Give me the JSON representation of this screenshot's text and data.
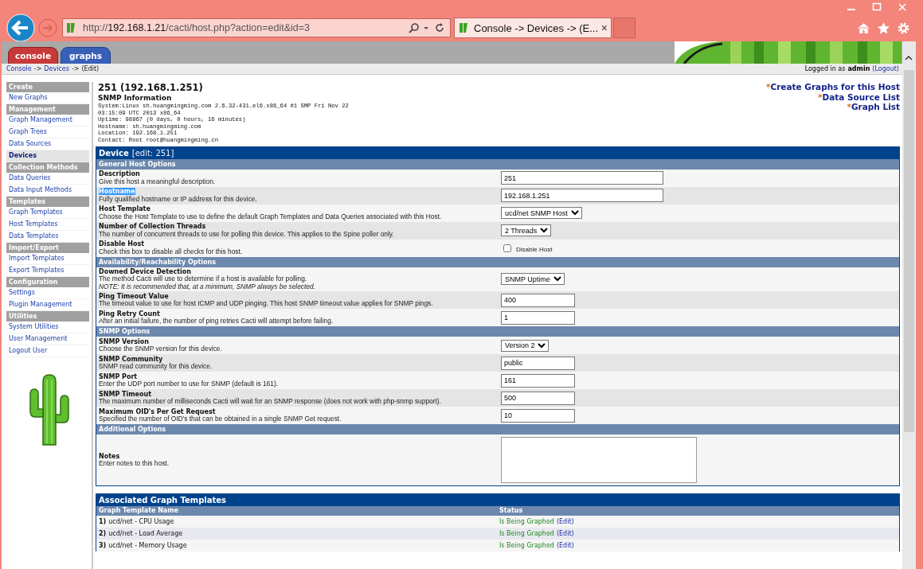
{
  "browser": {
    "url_scheme": "http://",
    "url_host": "192.168.1.21",
    "url_path": "/cacti/host.php?action=edit&id=3",
    "tab_title": "Console -> Devices -> (E...",
    "tab_close": "×"
  },
  "nav_tabs": [
    {
      "label": "console",
      "selected": true
    },
    {
      "label": "graphs",
      "selected": false
    }
  ],
  "breadcrumb": [
    {
      "kind": "link",
      "text": "Console"
    },
    {
      "kind": "sep",
      "text": "->"
    },
    {
      "kind": "link",
      "text": "Devices"
    },
    {
      "kind": "sep",
      "text": "->"
    },
    {
      "kind": "text",
      "text": "(Edit)"
    }
  ],
  "login": {
    "prefix": "Logged in as",
    "user": "admin",
    "logout": "(Logout)"
  },
  "sidebar": [
    {
      "title": "Create",
      "items": [
        {
          "label": "New Graphs",
          "selected": false
        }
      ]
    },
    {
      "title": "Management",
      "items": [
        {
          "label": "Graph Management",
          "selected": false
        },
        {
          "label": "Graph Trees",
          "selected": false
        },
        {
          "label": "Data Sources",
          "selected": false
        },
        {
          "label": "Devices",
          "selected": true
        }
      ]
    },
    {
      "title": "Collection Methods",
      "items": [
        {
          "label": "Data Queries",
          "selected": false
        },
        {
          "label": "Data Input Methods",
          "selected": false
        }
      ]
    },
    {
      "title": "Templates",
      "items": [
        {
          "label": "Graph Templates",
          "selected": false
        },
        {
          "label": "Host Templates",
          "selected": false
        },
        {
          "label": "Data Templates",
          "selected": false
        }
      ]
    },
    {
      "title": "Import/Export",
      "items": [
        {
          "label": "Import Templates",
          "selected": false
        },
        {
          "label": "Export Templates",
          "selected": false
        }
      ]
    },
    {
      "title": "Configuration",
      "items": [
        {
          "label": "Settings",
          "selected": false
        },
        {
          "label": "Plugin Management",
          "selected": false
        }
      ]
    },
    {
      "title": "Utilities",
      "items": [
        {
          "label": "System Utilities",
          "selected": false
        },
        {
          "label": "User Management",
          "selected": false
        },
        {
          "label": "Logout User",
          "selected": false
        }
      ]
    }
  ],
  "header": {
    "title": "251 (192.168.1.251)",
    "snmp_title": "SNMP Information",
    "snmp_lines": [
      "System:Linux sh.huangmingming.com 2.6.32-431.el6.x86_64 #1 SMP Fri Nov 22",
      "03:15:09 UTC 2013 x86_64",
      "Uptime: 98967 (0 days, 0 hours, 16 minutes)",
      "Hostname: sh.huangmingming.com",
      "Location: 192.168.1.251",
      "Contact: Root root@huangmingming.cn"
    ],
    "links": [
      {
        "mark": "*",
        "label": "Create Graphs for this Host"
      },
      {
        "mark": "*",
        "label": "Data Source List"
      },
      {
        "mark": "*",
        "label": "Graph List"
      }
    ]
  },
  "form": {
    "title": "Device",
    "subtitle": "[edit: 251]",
    "sections": [
      {
        "title": "General Host Options",
        "rows": [
          {
            "label": "Description",
            "description": "Give this host a meaningful description.",
            "highlighted": false,
            "control": {
              "kind": "text_wide",
              "value": "251"
            }
          },
          {
            "label": "Hostname",
            "description": "Fully qualified hostname or IP address for this device.",
            "highlighted": true,
            "control": {
              "kind": "text_wide",
              "value": "192.168.1.251"
            }
          },
          {
            "label": "Host Template",
            "description": "Choose the Host Template to use to define the default Graph Templates and Data Queries associated with this Host.",
            "highlighted": false,
            "control": {
              "kind": "select",
              "value": "ucd/net SNMP Host"
            }
          },
          {
            "label": "Number of Collection Threads",
            "description": "The number of concurrent threads to use for polling this device. This applies to the Spine poller only.",
            "highlighted": false,
            "control": {
              "kind": "select",
              "value": "2 Threads"
            }
          },
          {
            "label": "Disable Host",
            "description": "Check this box to disable all checks for this host.",
            "highlighted": false,
            "control": {
              "kind": "checkbox",
              "checked": false,
              "caption": "Disable Host"
            }
          }
        ]
      },
      {
        "title": "Availability/Reachability Options",
        "rows": [
          {
            "label": "Downed Device Detection",
            "description": "The method Cacti will use to determine if a host is available for polling.",
            "note": "NOTE: It is recommended that, at a minimum, SNMP always be selected.",
            "highlighted": false,
            "control": {
              "kind": "select",
              "value": "SNMP Uptime"
            }
          },
          {
            "label": "Ping Timeout Value",
            "description": "The timeout value to use for host ICMP and UDP pinging. This host SNMP timeout value applies for SNMP pings.",
            "highlighted": false,
            "control": {
              "kind": "text_short",
              "value": "400"
            }
          },
          {
            "label": "Ping Retry Count",
            "description": "After an initial failure, the number of ping retries Cacti will attempt before failing.",
            "highlighted": false,
            "control": {
              "kind": "text_short",
              "value": "1"
            }
          }
        ]
      },
      {
        "title": "SNMP Options",
        "rows": [
          {
            "label": "SNMP Version",
            "description": "Choose the SNMP version for this device.",
            "highlighted": false,
            "control": {
              "kind": "select",
              "value": "Version 2"
            }
          },
          {
            "label": "SNMP Community",
            "description": "SNMP read community for this device.",
            "highlighted": false,
            "control": {
              "kind": "text_short",
              "value": "public"
            }
          },
          {
            "label": "SNMP Port",
            "description": "Enter the UDP port number to use for SNMP (default is 161).",
            "highlighted": false,
            "control": {
              "kind": "text_short",
              "value": "161"
            }
          },
          {
            "label": "SNMP Timeout",
            "description": "The maximum number of milliseconds Cacti will wait for an SNMP response (does not work with php-snmp support).",
            "highlighted": false,
            "control": {
              "kind": "text_short",
              "value": "500"
            }
          },
          {
            "label": "Maximum OID's Per Get Request",
            "description": "Specified the number of OID's that can be obtained in a single SNMP Get request.",
            "highlighted": false,
            "control": {
              "kind": "text_short",
              "value": "10"
            }
          }
        ]
      },
      {
        "title": "Additional Options",
        "rows": [
          {
            "label": "Notes",
            "description": "Enter notes to this host.",
            "highlighted": false,
            "control": {
              "kind": "textarea"
            }
          }
        ]
      }
    ]
  },
  "graph_templates": {
    "title": "Associated Graph Templates",
    "columns": [
      "Graph Template Name",
      "Status"
    ],
    "rows": [
      {
        "index": "1)",
        "name": "ucd/net - CPU Usage",
        "status": "Is Being Graphed",
        "action": "(Edit)"
      },
      {
        "index": "2)",
        "name": "ucd/net - Load Average",
        "status": "Is Being Graphed",
        "action": "(Edit)"
      },
      {
        "index": "3)",
        "name": "ucd/net - Memory Usage",
        "status": "Is Being Graphed",
        "action": "(Edit)"
      }
    ]
  }
}
